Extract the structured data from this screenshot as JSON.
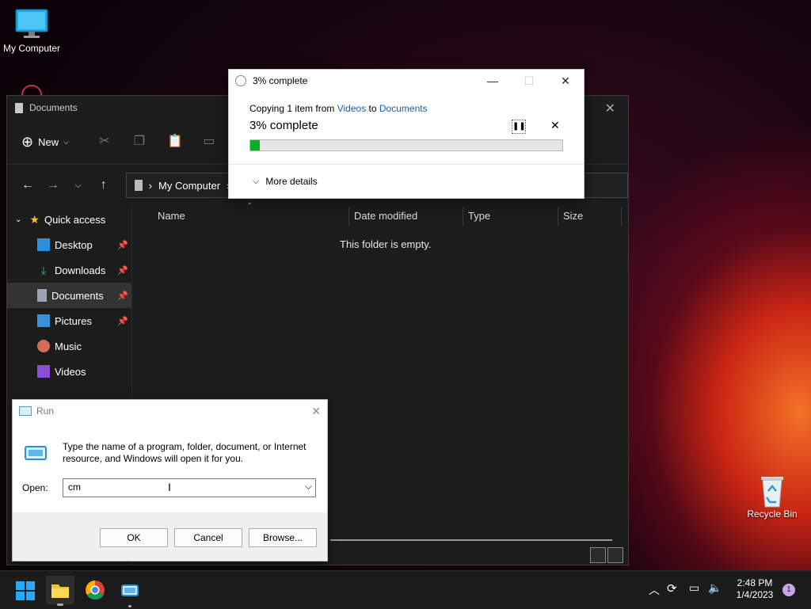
{
  "desktop": {
    "icons": [
      {
        "label": "My Computer",
        "icon": "monitor-icon"
      },
      {
        "label": "Recycle Bin",
        "icon": "recycle-bin-icon"
      }
    ]
  },
  "explorer": {
    "title": "Documents",
    "toolbar": {
      "new_label": "New"
    },
    "address": {
      "crumb": "My Computer"
    },
    "nav": {
      "quick_access": "Quick access",
      "items": [
        {
          "label": "Desktop",
          "pinned": true
        },
        {
          "label": "Downloads",
          "pinned": true
        },
        {
          "label": "Documents",
          "pinned": true
        },
        {
          "label": "Pictures",
          "pinned": true
        },
        {
          "label": "Music",
          "pinned": false
        },
        {
          "label": "Videos",
          "pinned": false
        }
      ]
    },
    "columns": [
      "Name",
      "Date modified",
      "Type",
      "Size"
    ],
    "empty_message": "This folder is empty."
  },
  "copy_dialog": {
    "title": "3% complete",
    "copying_prefix": "Copying 1 item from ",
    "source": "Videos",
    "to_word": " to ",
    "dest": "Documents",
    "percent_text": "3% complete",
    "progress_percent": 3,
    "more_details": "More details"
  },
  "run_dialog": {
    "title": "Run",
    "description": "Type the name of a program, folder, document, or Internet resource, and Windows will open it for you.",
    "open_label": "Open:",
    "input_value": "cm",
    "ok": "OK",
    "cancel": "Cancel",
    "browse": "Browse..."
  },
  "taskbar": {
    "time": "2:48 PM",
    "date": "1/4/2023",
    "notification_count": "1"
  },
  "colors": {
    "progress_fill": "#06b025",
    "link": "#1a5fb4",
    "accent": "#0078d4"
  }
}
